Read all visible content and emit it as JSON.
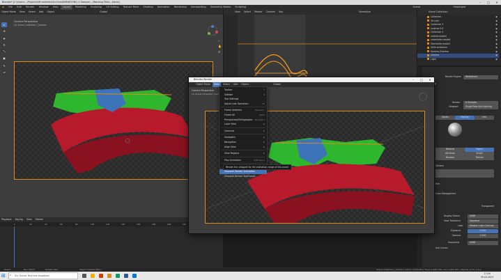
{
  "window": {
    "title": "Blender* [C:\\Users\\...\\Projects\\Mirrorbilder\\Archive\\ANIMATION\\1.0 Sample\\...\\Working Files\\...blend]"
  },
  "menubar": {
    "items": [
      "File",
      "Edit",
      "Render",
      "Window",
      "Help"
    ],
    "workspaces": [
      "Layout",
      "Modeling",
      "Sculpting",
      "UV Editing",
      "Texture Paint",
      "Shading",
      "Animation",
      "Rendering",
      "Compositing",
      "Geometry Nodes",
      "Scripting"
    ],
    "active_workspace": "Layout",
    "scene_label": "Scene",
    "view_layer_label": "ViewLayer"
  },
  "viewport3d": {
    "header_items": [
      "Object Mode",
      "View",
      "Select",
      "Add",
      "Object"
    ],
    "transform": "Global",
    "perspective_label": "Camera Perspective",
    "collection_label": "(1) Scene Collection | Camera"
  },
  "graph_editor": {
    "header_items": [
      "View",
      "Select",
      "Marker",
      "Channel",
      "Key"
    ],
    "normalize": "Normalize",
    "frame_marks": [
      "0",
      "20",
      "40",
      "60",
      "80",
      "100",
      "120",
      "140"
    ]
  },
  "timeline": {
    "header_items": [
      "Playback",
      "Keying",
      "View",
      "Marker"
    ],
    "frame_marks": [
      "0",
      "20",
      "40",
      "60",
      "80",
      "100",
      "120",
      "140",
      "160",
      "180",
      "200",
      "220",
      "240",
      "260"
    ]
  },
  "render_window": {
    "title": "Blender Render",
    "header_items": [
      "Object Mode",
      "View",
      "Select",
      "Add",
      "Object"
    ],
    "transform": "Global",
    "perspective_label": "Camera Perspective",
    "collection_label": "(1) Scene Collection | Camera"
  },
  "view_menu": {
    "items": [
      {
        "label": "Toolbar",
        "shortcut": "T",
        "arrow": false
      },
      {
        "label": "Sidebar",
        "shortcut": "N",
        "arrow": false
      },
      {
        "label": "Tool Settings",
        "shortcut": "",
        "arrow": false
      },
      {
        "label": "Adjust Last Operation",
        "shortcut": "F9",
        "arrow": false
      },
      {
        "sep": true
      },
      {
        "label": "Frame Selected",
        "shortcut": "Numpad .",
        "arrow": false
      },
      {
        "label": "Frame All",
        "shortcut": "Home",
        "arrow": false
      },
      {
        "label": "Perspective/Orthographic",
        "shortcut": "Numpad 5",
        "arrow": false
      },
      {
        "label": "Local View",
        "shortcut": "",
        "arrow": true
      },
      {
        "sep": true
      },
      {
        "label": "Cameras",
        "shortcut": "",
        "arrow": true
      },
      {
        "sep": true
      },
      {
        "label": "Viewpoint",
        "shortcut": "",
        "arrow": true
      },
      {
        "label": "Navigation",
        "shortcut": "",
        "arrow": true
      },
      {
        "label": "Align View",
        "shortcut": "",
        "arrow": true
      },
      {
        "sep": true
      },
      {
        "label": "View Regions",
        "shortcut": "",
        "arrow": true
      },
      {
        "sep": true
      },
      {
        "label": "Play Animation",
        "shortcut": "Shift Space",
        "arrow": false
      },
      {
        "sep": true
      },
      {
        "label": "Viewport Render Image",
        "shortcut": "",
        "arrow": false
      },
      {
        "label": "Viewport Render Animation",
        "shortcut": "",
        "arrow": false,
        "highlight": true
      },
      {
        "label": "Viewport Render Keyframes",
        "shortcut": "",
        "arrow": false
      }
    ],
    "tooltip": "Render the viewport for the animation range of this scene"
  },
  "outliner": {
    "title": "Scene Collection",
    "rows": [
      {
        "label": "Collection"
      },
      {
        "label": "3d ruler"
      },
      {
        "label": "Collection 3"
      },
      {
        "label": "Lenkrad 9.0"
      },
      {
        "label": "Collection 4"
      },
      {
        "label": "unterer.modell"
      },
      {
        "label": "unterkiefer.modell"
      },
      {
        "label": "Oberkiefer.modell"
      },
      {
        "label": "Zeile aufsetzen"
      },
      {
        "label": "Kamera-Zubehor"
      },
      {
        "label": "Camera",
        "selected": true
      },
      {
        "label": "Light"
      }
    ]
  },
  "properties": {
    "render_engine_label": "Render Engine",
    "render_engine": "Workbench",
    "sampling_label": "Sampling",
    "render_label": "Render",
    "render_value": "8 Samples",
    "viewport_label": "Viewport",
    "viewport_value": "Single Pass Anti-Aliasing",
    "lighting_tabs": [
      "Studio",
      "MatCap",
      "Flat"
    ],
    "color_label": "Color",
    "color_tabs": [
      "Material",
      "Object",
      "Attribute",
      "Single",
      "Random",
      "Texture"
    ],
    "options_label": "Options",
    "film_label": "Film",
    "color_mgmt_label": "Color Management",
    "transparent_label": "Transparent",
    "display_device_label": "Display Device",
    "display_device": "sRGB",
    "view_transform_label": "View Transform",
    "view_transform": "Standard",
    "look_label": "Look",
    "look_value": "Medium High Contrast",
    "exposure_label": "Exposure",
    "exposure_value": "0.000",
    "gamma_label": "Gamma",
    "gamma_value": "1.000",
    "sequencer_label": "Sequencer",
    "sequencer_value": "sRGB",
    "use_curves_label": "Use Curves"
  },
  "statusbar": {
    "left_items": [
      "Select",
      "Box Select",
      "Rotate View",
      "Object Context Menu"
    ],
    "right_text": "Scene Collection | Camera | Verts 1,234,567 | Faces 2,469,120 | Tris 2,469,130 | Objects 1/13 | 3.3.1"
  },
  "taskbar": {
    "search_placeholder": "Zur Suche Text hier eingeben",
    "time": "17:09",
    "date": "09.03.2023"
  },
  "colors": {
    "accent": "#4772b3",
    "camera_frame": "#e08a18",
    "model_green": "#2fb62f",
    "model_red": "#b61a2b",
    "model_blue": "#3d73b8",
    "curve_orange": "#ff9a1a"
  }
}
